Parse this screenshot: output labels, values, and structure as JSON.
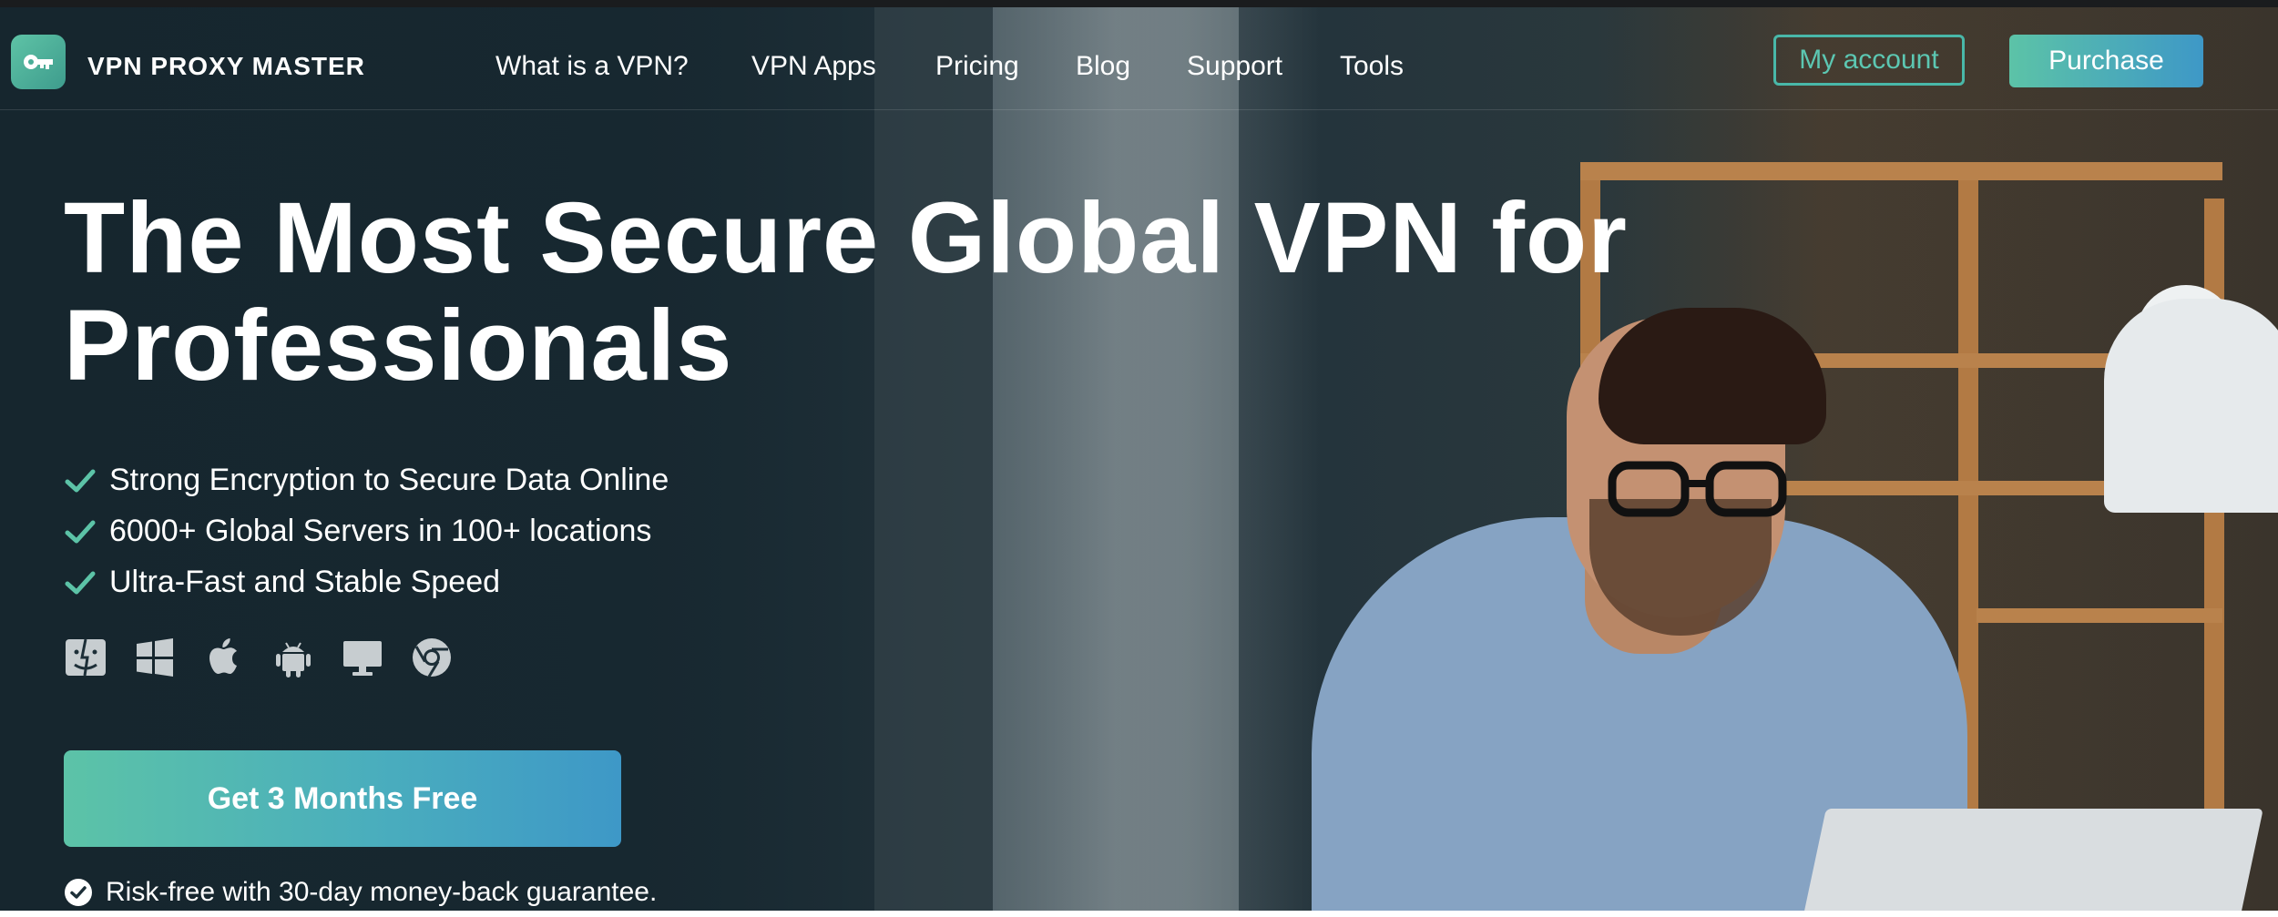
{
  "brand": {
    "name": "VPN PROXY MASTER"
  },
  "nav": {
    "items": [
      {
        "label": "What is a VPN?"
      },
      {
        "label": "VPN Apps"
      },
      {
        "label": "Pricing"
      },
      {
        "label": "Blog"
      },
      {
        "label": "Support"
      },
      {
        "label": "Tools"
      }
    ],
    "account_label": "My account",
    "purchase_label": "Purchase"
  },
  "hero": {
    "title_line1": "The Most Secure Global VPN for",
    "title_line2": "Professionals",
    "features": [
      "Strong Encryption to Secure Data Online",
      "6000+ Global Servers in 100+ locations",
      "Ultra-Fast and Stable Speed"
    ],
    "platforms": [
      "finder-icon",
      "windows-icon",
      "apple-icon",
      "android-icon",
      "monitor-icon",
      "chrome-icon"
    ],
    "cta_label": "Get 3 Months Free",
    "guarantee": "Risk-free with 30-day money-back guarantee."
  },
  "colors": {
    "accent_green": "#5cc3a7",
    "accent_blue": "#3e98c7",
    "hero_bg": "#1d2f38"
  }
}
